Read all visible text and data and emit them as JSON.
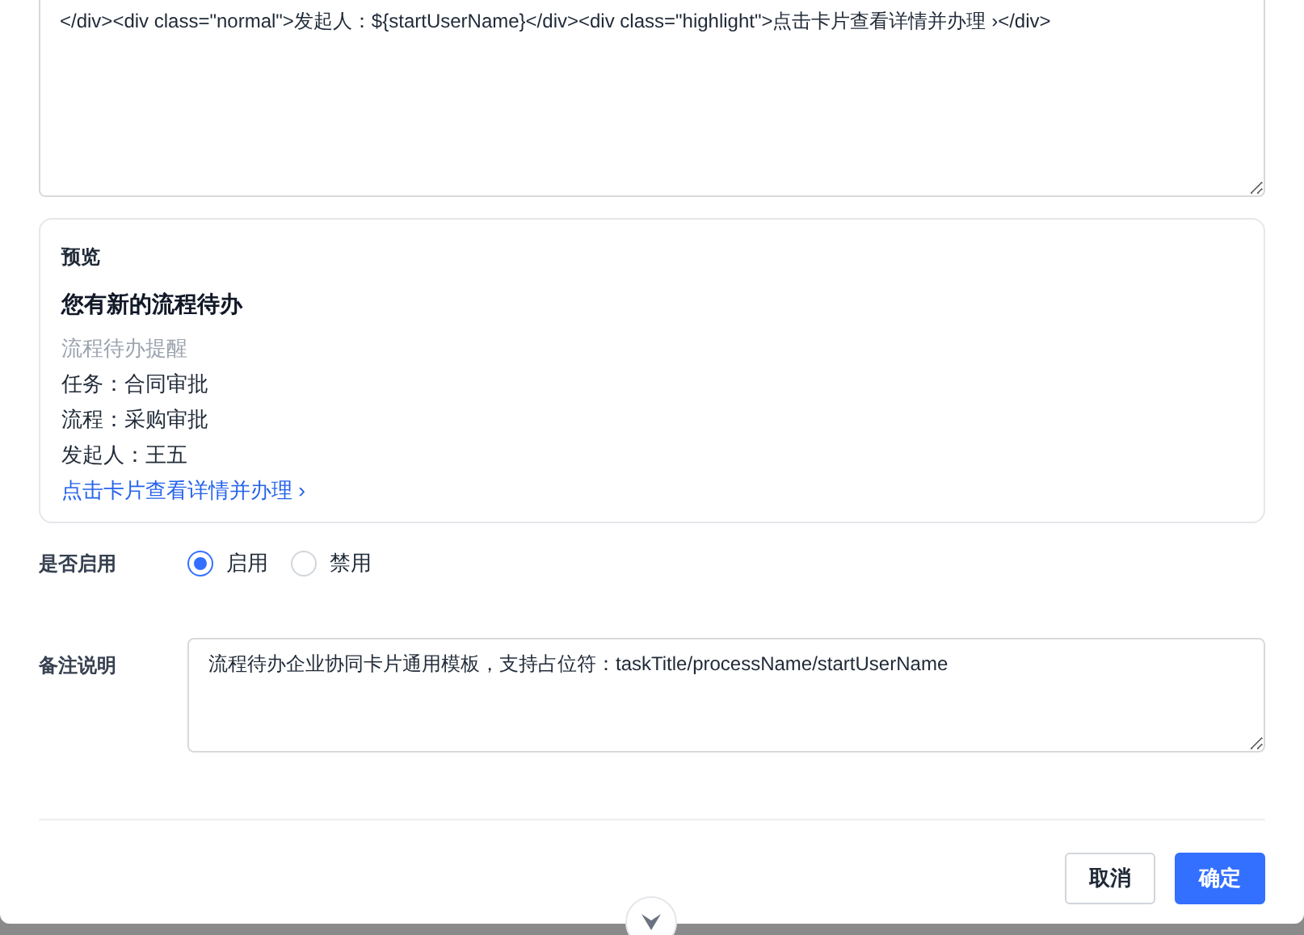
{
  "template_field": {
    "value": "</div><div class=\"normal\">发起人：${startUserName}</div><div class=\"highlight\">点击卡片查看详情并办理 ›</div>"
  },
  "preview": {
    "label": "预览",
    "title": "您有新的流程待办",
    "lines": [
      {
        "kind": "muted",
        "text": "流程待办提醒"
      },
      {
        "kind": "normal",
        "text": "任务：合同审批"
      },
      {
        "kind": "normal",
        "text": "流程：采购审批"
      },
      {
        "kind": "normal",
        "text": "发起人：王五"
      },
      {
        "kind": "link",
        "text": "点击卡片查看详情并办理 ›"
      }
    ]
  },
  "enabled": {
    "label": "是否启用",
    "options": [
      {
        "label": "启用",
        "selected": true
      },
      {
        "label": "禁用",
        "selected": false
      }
    ]
  },
  "remarks": {
    "label": "备注说明",
    "value": "流程待办企业协同卡片通用模板，支持占位符：taskTitle/processName/startUserName"
  },
  "buttons": [
    {
      "kind": "secondary",
      "label": "取消"
    },
    {
      "kind": "primary",
      "label": "确定"
    }
  ]
}
